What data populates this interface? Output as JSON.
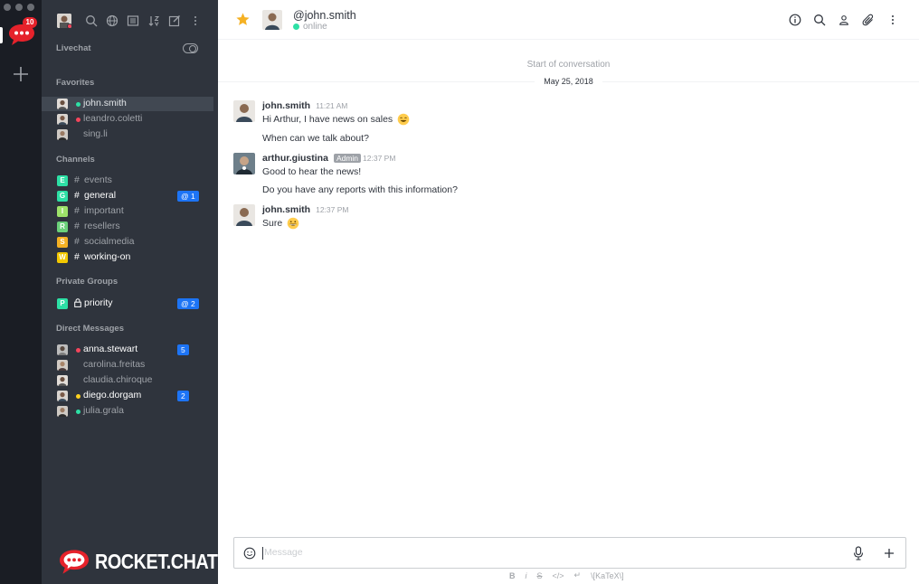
{
  "server_rail": {
    "badge": "10",
    "icons": [
      "rocket-chat-server-icon",
      "add-server-icon"
    ]
  },
  "sidebar": {
    "livechat_label": "Livechat",
    "sections": {
      "favorites": "Favorites",
      "channels": "Channels",
      "private_groups": "Private Groups",
      "direct_messages": "Direct Messages"
    },
    "favorites": [
      {
        "name": "john.smith",
        "status_color": "#2de0a5",
        "active": true
      },
      {
        "name": "leandro.coletti",
        "status_color": "#f5455c"
      },
      {
        "name": "sing.li",
        "status_color": ""
      }
    ],
    "channels": [
      {
        "letter": "E",
        "color": "#2de0a5",
        "name": "events"
      },
      {
        "letter": "G",
        "color": "#2de0a5",
        "name": "general",
        "bold": true,
        "badge": "@ 1"
      },
      {
        "letter": "I",
        "color": "#9ee36a",
        "name": "important"
      },
      {
        "letter": "R",
        "color": "#6bd17a",
        "name": "resellers"
      },
      {
        "letter": "S",
        "color": "#f5b123",
        "name": "socialmedia"
      },
      {
        "letter": "W",
        "color": "#f3c800",
        "name": "working-on",
        "bold": true
      }
    ],
    "private_groups": [
      {
        "letter": "P",
        "color": "#2de0a5",
        "name": "priority",
        "bold": true,
        "badge": "@ 2"
      }
    ],
    "direct_messages": [
      {
        "name": "anna.stewart",
        "status_color": "#f5455c",
        "bold": true,
        "badge": "5"
      },
      {
        "name": "carolina.freitas",
        "status_color": ""
      },
      {
        "name": "claudia.chiroque",
        "status_color": ""
      },
      {
        "name": "diego.dorgam",
        "status_color": "#ffd21f",
        "bold": true,
        "badge": "2"
      },
      {
        "name": "julia.grala",
        "status_color": "#2de0a5"
      }
    ],
    "logo_text": "ROCKET.CHAT"
  },
  "header": {
    "title": "@john.smith",
    "status": "online"
  },
  "conversation": {
    "start_text": "Start of conversation",
    "date": "May 25, 2018",
    "messages": [
      {
        "user": "john.smith",
        "time": "11:21 AM",
        "lines": [
          "Hi Arthur, I have news on sales",
          "When can we talk about?"
        ]
      },
      {
        "user": "arthur.giustina",
        "role": "Admin",
        "time": "12:37 PM",
        "lines": [
          "Good to hear the news!",
          "Do you have any reports with this information?"
        ]
      },
      {
        "user": "john.smith",
        "time": "12:37 PM",
        "lines": [
          "Sure"
        ]
      }
    ]
  },
  "composer": {
    "placeholder": "Message",
    "format_toolbar": [
      "B",
      "i",
      "S",
      "</>",
      "↵",
      "\\[KaTeX\\]"
    ]
  },
  "colors": {
    "rail": "#1a1d24",
    "sidebar": "#2f343d",
    "brand_red": "#e5222b",
    "badge_blue": "#1d74f5",
    "online": "#2de0a5",
    "star": "#f5b123"
  }
}
